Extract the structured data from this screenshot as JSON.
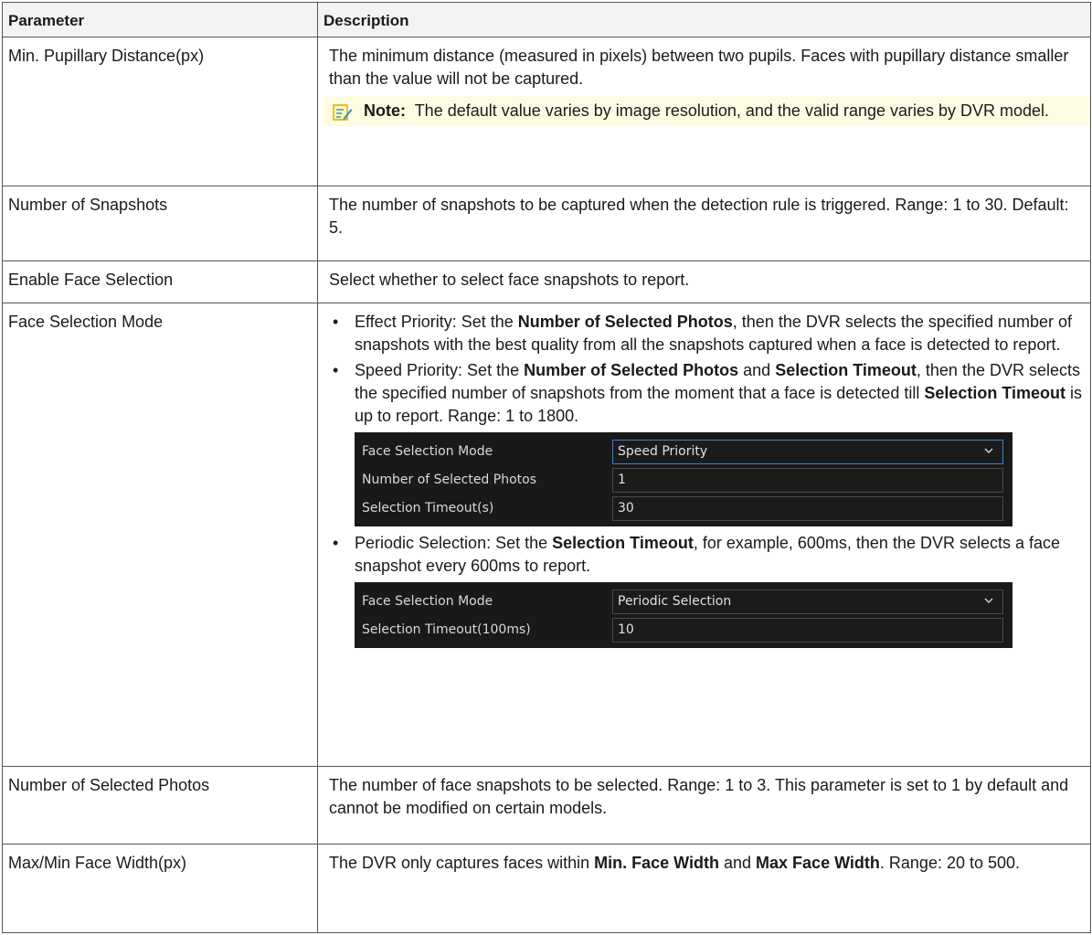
{
  "header": {
    "parameter": "Parameter",
    "description": "Description"
  },
  "rows": {
    "min_pupillary": {
      "name": "Min. Pupillary Distance(px)",
      "desc": "The minimum distance (measured in pixels) between two pupils. Faces with pupillary distance smaller than the value will not be captured.",
      "note_label": "Note:",
      "note_text": "The default value varies by image resolution, and the valid range varies by DVR model.",
      "note_icon": "note-pencil-icon"
    },
    "num_snapshots": {
      "name": "Number of Snapshots",
      "desc": "The number of snapshots to be captured when the detection rule is triggered. Range: 1 to 30. Default: 5."
    },
    "enable_face": {
      "name": "Enable Face Selection",
      "desc": "Select whether to select face snapshots to report."
    },
    "face_mode": {
      "name": "Face Selection Mode",
      "b1_a": "Effect Priority: Set the ",
      "b1_b": "Number of Selected Photos",
      "b1_c": ", then the DVR selects the specified number of snapshots with the best quality from all the snapshots captured when a face is detected to report.",
      "b2_a": "Speed Priority: Set the ",
      "b2_b": "Number of Selected Photos",
      "b2_c": " and ",
      "b2_d": "Selection Timeout",
      "b2_e": ", then the DVR selects the specified number of snapshots from the moment that a face is detected till ",
      "b2_f": "Selection Timeout",
      "b2_g": " is up to report. Range: 1 to 1800.",
      "shot1": {
        "r1_label": "Face Selection Mode",
        "r1_value": "Speed Priority",
        "r2_label": "Number of Selected Photos",
        "r2_value": "1",
        "r3_label": "Selection Timeout(s)",
        "r3_value": "30"
      },
      "b3_a": "Periodic Selection: Set the ",
      "b3_b": "Selection Timeout",
      "b3_c": ", for example, 600ms, then the DVR selects a face snapshot every 600ms to report.",
      "shot2": {
        "r1_label": "Face Selection Mode",
        "r1_value": "Periodic Selection",
        "r2_label": "Selection Timeout(100ms)",
        "r2_value": "10"
      }
    },
    "num_selected": {
      "name": "Number of Selected Photos",
      "desc": "The number of face snapshots to be selected. Range: 1 to 3. This parameter is set to 1 by default and cannot be modified on certain models."
    },
    "face_width": {
      "name": "Max/Min Face Width(px)",
      "d_a": "The DVR only captures faces within ",
      "d_b": "Min. Face Width",
      "d_c": " and ",
      "d_d": "Max Face Width",
      "d_e": ". Range: 20 to 500."
    }
  },
  "colors": {
    "note_bg": "#fdfce3",
    "shot_bg": "#191919",
    "accent": "#3d7ed6"
  }
}
